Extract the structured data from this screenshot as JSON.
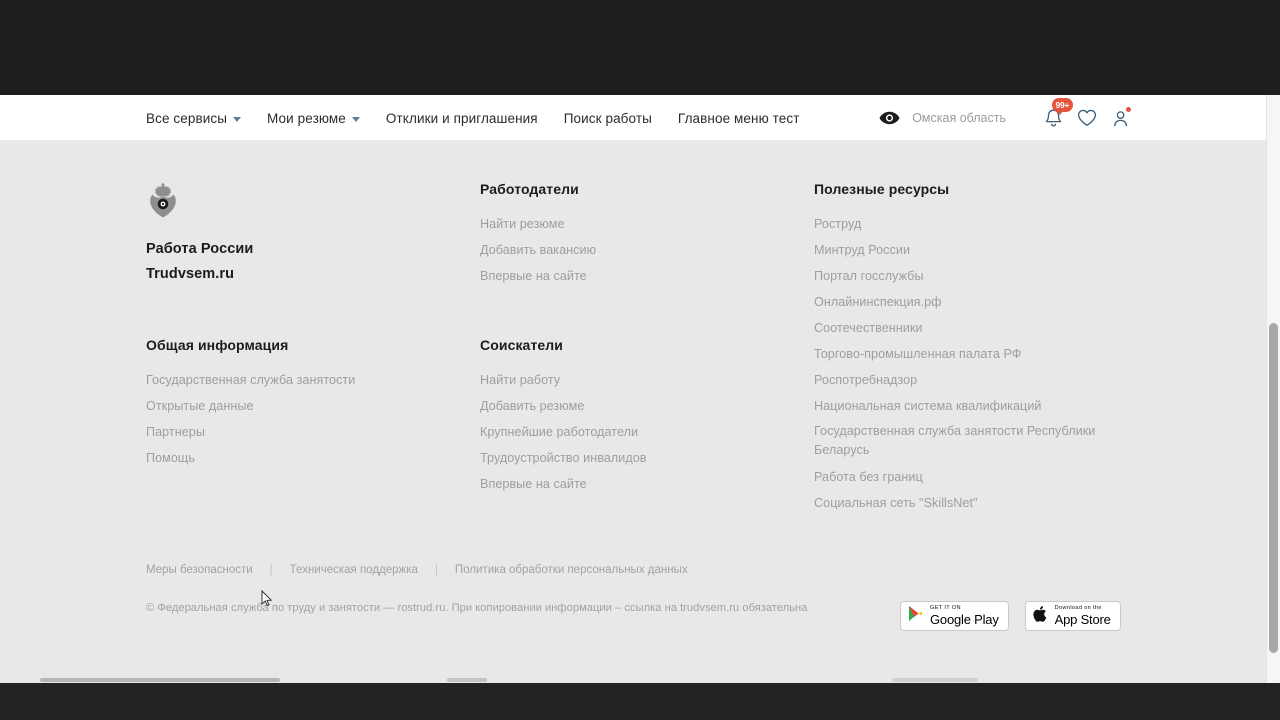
{
  "header": {
    "nav": [
      {
        "label": "Все сервисы",
        "has_caret": true,
        "name": "nav-all-services"
      },
      {
        "label": "Мои резюме",
        "has_caret": true,
        "name": "nav-my-resumes"
      },
      {
        "label": "Отклики и приглашения",
        "has_caret": false,
        "name": "nav-responses-invitations"
      },
      {
        "label": "Поиск работы",
        "has_caret": false,
        "name": "nav-job-search"
      },
      {
        "label": "Главное меню тест",
        "has_caret": false,
        "name": "nav-main-menu-test"
      }
    ],
    "accessibility_icon": "eye-icon",
    "region": "Омская область",
    "notifications_badge": "99+",
    "icons": [
      "bell-icon",
      "heart-icon",
      "user-icon"
    ]
  },
  "footer": {
    "brand": {
      "emblem": "russian-coat-of-arms-icon",
      "line1": "Работа России",
      "line2": "Trudvsem.ru"
    },
    "columns": [
      {
        "title": "Общая информация",
        "items": [
          "Государственная служба занятости",
          "Открытые данные",
          "Партнеры",
          "Помощь"
        ]
      },
      {
        "title": "Работодатели",
        "items": [
          "Найти резюме",
          "Добавить вакансию",
          "Впервые на сайте"
        ]
      },
      {
        "title": "Соискатели",
        "items": [
          "Найти работу",
          "Добавить резюме",
          "Крупнейшие работодатели",
          "Трудоустройство инвалидов",
          "Впервые на сайте"
        ]
      },
      {
        "title": "Полезные ресурсы",
        "items": [
          "Роструд",
          "Минтруд России",
          "Портал госслужбы",
          "Онлайнинспекция.рф",
          "Соотечественники",
          "Торгово-промышленная палата РФ",
          "Роспотребнадзор",
          "Национальная система квалификаций",
          "Государственная служба занятости Республики Беларусь",
          "Работа без границ",
          "Социальная сеть \"SkillsNet\""
        ]
      }
    ],
    "legal_links": [
      "Меры безопасности",
      "Техническая поддержка",
      "Политика обработки персональных данных"
    ],
    "legal_separator": "|",
    "copyright": "© Федеральная служба по труду и занятости — rostrud.ru. При копировании информации – ссылка на trudvsem.ru обязательна",
    "stores": [
      {
        "top": "GET IT ON",
        "main": "Google Play",
        "icon": "google-play-icon"
      },
      {
        "top": "Download on the",
        "main": "App Store",
        "icon": "apple-icon"
      }
    ]
  },
  "colors": {
    "accent_red": "#e4543a",
    "page_bg": "#e8e8e8",
    "header_bg": "#ffffff",
    "chrome": "#1e1e20",
    "link_gray": "#9e9e9e",
    "title_dark": "#1c1c1c"
  }
}
